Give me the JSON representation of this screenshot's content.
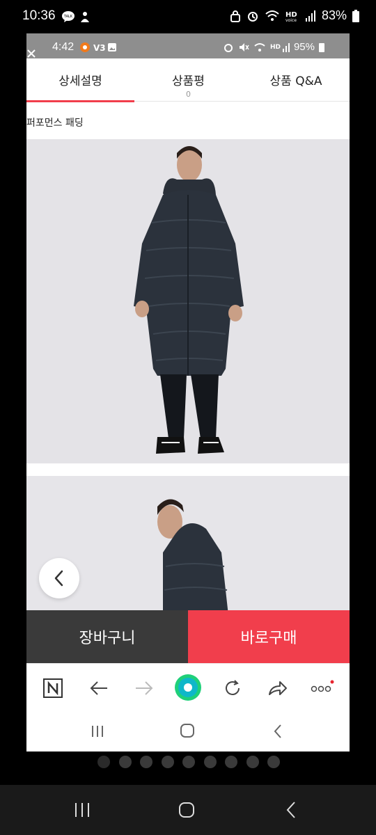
{
  "outer_status": {
    "time": "10:36",
    "battery": "83%"
  },
  "inner_status": {
    "time": "4:42",
    "battery": "95%"
  },
  "tabs": [
    {
      "label": "상세설명",
      "count": ""
    },
    {
      "label": "상품평",
      "count": "0"
    },
    {
      "label": "상품 Q&A",
      "count": ""
    }
  ],
  "product": {
    "title": "퍼포먼스 패딩"
  },
  "buttons": {
    "cart": "장바구니",
    "buy": "바로구매"
  },
  "colors": {
    "accent": "#f13e4c",
    "cart_bg": "#3a3a3a"
  },
  "toolbar_icons": [
    "n-home-icon",
    "back-arrow-icon",
    "forward-arrow-icon",
    "green-circle-icon",
    "refresh-icon",
    "share-icon",
    "more-icon"
  ],
  "page_indicator": {
    "count": 9,
    "active_index": 0
  }
}
